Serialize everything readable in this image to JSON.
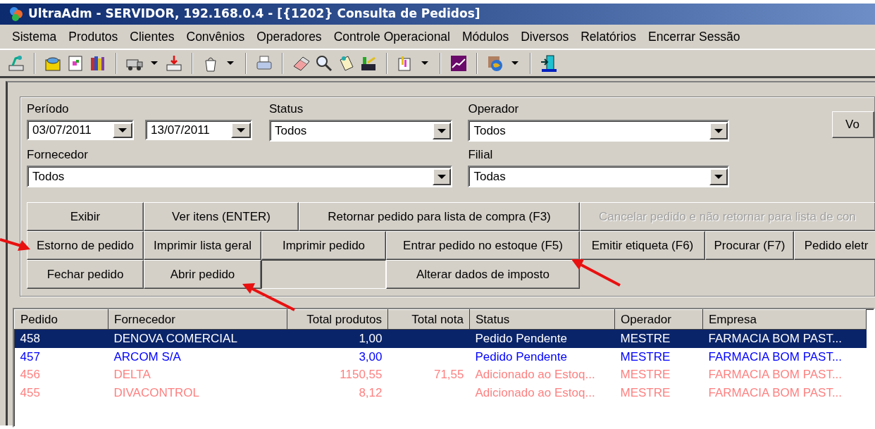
{
  "window": {
    "title": "UltraAdm - SERVIDOR, 192.168.0.4 - [{1202} Consulta de Pedidos]"
  },
  "menu": [
    "Sistema",
    "Produtos",
    "Clientes",
    "Convênios",
    "Operadores",
    "Controle Operacional",
    "Módulos",
    "Diversos",
    "Relatórios",
    "Encerrar Sessão"
  ],
  "filters": {
    "periodo": {
      "label": "Período",
      "from": "03/07/2011",
      "to": "13/07/2011"
    },
    "status": {
      "label": "Status",
      "value": "Todos"
    },
    "operador": {
      "label": "Operador",
      "value": "Todos"
    },
    "fornecedor": {
      "label": "Fornecedor",
      "value": "Todos"
    },
    "filial": {
      "label": "Filial",
      "value": "Todas"
    }
  },
  "side_button": "Vo",
  "action_rows": [
    [
      {
        "kind": "button",
        "label": "Exibir",
        "disabled": false
      },
      {
        "kind": "button",
        "label": "Ver itens (ENTER)",
        "disabled": false
      },
      {
        "kind": "button",
        "label": "Retornar pedido para lista de compra (F3)",
        "disabled": false
      },
      {
        "kind": "button",
        "label": "Cancelar pedido e não retornar para lista de con",
        "disabled": true
      }
    ],
    [
      {
        "kind": "button",
        "label": "Estorno de pedido",
        "disabled": false
      },
      {
        "kind": "button",
        "label": "Imprimir lista geral",
        "disabled": false
      },
      {
        "kind": "button",
        "label": "Imprimir pedido",
        "disabled": false
      },
      {
        "kind": "button",
        "label": "Entrar pedido no estoque (F5)",
        "disabled": false
      },
      {
        "kind": "button",
        "label": "Emitir etiqueta (F6)",
        "disabled": false
      },
      {
        "kind": "button",
        "label": "Procurar (F7)",
        "disabled": false
      },
      {
        "kind": "button",
        "label": "Pedido eletr",
        "disabled": false
      }
    ],
    [
      {
        "kind": "button",
        "label": "Fechar pedido",
        "disabled": false
      },
      {
        "kind": "button",
        "label": "Abrir pedido",
        "disabled": false
      },
      {
        "kind": "blank"
      },
      {
        "kind": "button",
        "label": "Alterar dados de imposto",
        "disabled": false
      }
    ]
  ],
  "table": {
    "columns": [
      "Pedido",
      "Fornecedor",
      "Total produtos",
      "Total nota",
      "Status",
      "Operador",
      "Empresa"
    ],
    "rows": [
      {
        "selected": true,
        "cells": [
          "458",
          "DENOVA COMERCIAL",
          "1,00",
          "",
          "Pedido Pendente",
          "MESTRE",
          "FARMACIA BOM PAST..."
        ]
      },
      {
        "selected": false,
        "color": "#0000ff",
        "cells": [
          "457",
          "ARCOM S/A",
          "3,00",
          "",
          "Pedido Pendente",
          "MESTRE",
          "FARMACIA BOM PAST..."
        ]
      },
      {
        "selected": false,
        "color": "#ff8080",
        "cells": [
          "456",
          "DELTA",
          "1150,55",
          "71,55",
          "Adicionado ao Estoq...",
          "MESTRE",
          "FARMACIA BOM PAST..."
        ]
      },
      {
        "selected": false,
        "color": "#ff8080",
        "cells": [
          "455",
          "DIVACONTROL",
          "8,12",
          "",
          "Adicionado ao Estoq...",
          "MESTRE",
          "FARMACIA BOM PAST..."
        ]
      }
    ]
  }
}
